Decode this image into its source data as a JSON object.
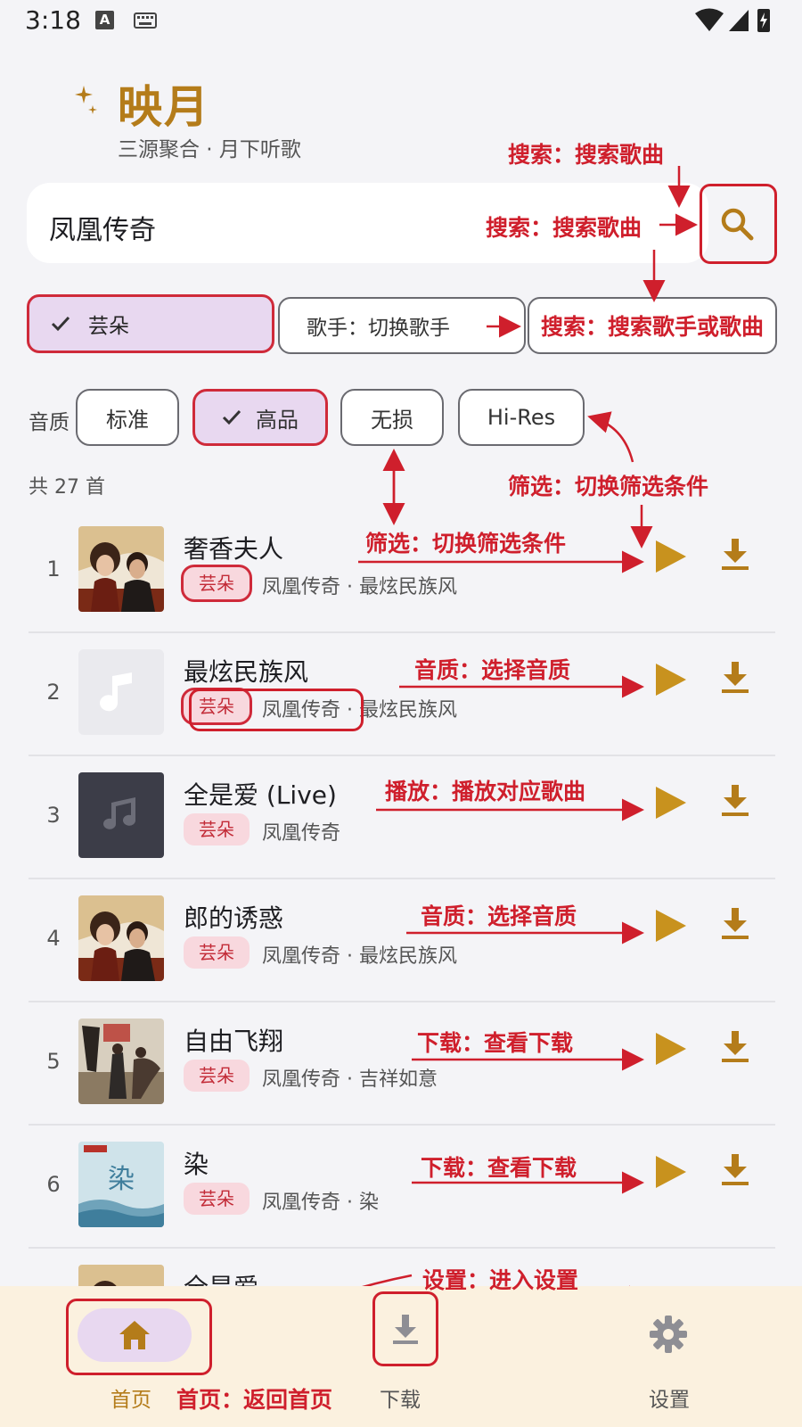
{
  "status": {
    "time": "3:18",
    "a_icon": "A"
  },
  "app": {
    "title": "映月",
    "subtitle": "三源聚合 · 月下听歌"
  },
  "search": {
    "value": "凤凰传奇"
  },
  "sources": [
    {
      "label": "芸朵",
      "active": true
    },
    {
      "label": "歌手：切换歌手",
      "active": false
    },
    {
      "label": "搜索：搜索歌手或歌曲",
      "active": false
    }
  ],
  "quality": {
    "label": "音质",
    "options": [
      {
        "label": "标准",
        "active": false
      },
      {
        "label": "高品",
        "active": true
      },
      {
        "label": "无损",
        "active": false
      },
      {
        "label": "Hi-Res",
        "active": false
      }
    ]
  },
  "list": {
    "count": "共 27 首",
    "songs": [
      {
        "index": "1",
        "title": "奢香夫人",
        "tag": "芸朵",
        "meta": "凤凰传奇 · 最炫民族风",
        "cover": "photo-duo"
      },
      {
        "index": "2",
        "title": "最炫民族风",
        "tag": "芸朵",
        "meta": "凤凰传奇 · 最炫民族风",
        "cover": "placeholder-light"
      },
      {
        "index": "3",
        "title": "全是爱 (Live)",
        "tag": "芸朵",
        "meta": "凤凰传奇",
        "cover": "placeholder-dark"
      },
      {
        "index": "4",
        "title": "郎的诱惑",
        "tag": "芸朵",
        "meta": "凤凰传奇 · 最炫民族风",
        "cover": "photo-duo"
      },
      {
        "index": "5",
        "title": "自由飞翔",
        "tag": "芸朵",
        "meta": "凤凰传奇 · 吉祥如意",
        "cover": "photo-sepia"
      },
      {
        "index": "6",
        "title": "染",
        "tag": "芸朵",
        "meta": "凤凰传奇 · 染",
        "cover": "photo-blue"
      },
      {
        "index": "",
        "title": "全是爱",
        "tag": "",
        "meta": "",
        "cover": "photo-duo"
      }
    ]
  },
  "nav": {
    "home": "首页",
    "downloads": "下载",
    "settings": "设置"
  },
  "annotations": {
    "search_top": "搜索：搜索歌曲",
    "search_mid": "搜索：搜索歌曲",
    "filter_right": "筛选：切换筛选条件",
    "filter_row1": "筛选：切换筛选条件",
    "quality_row2": "音质：选择音质",
    "play_row3": "播放：播放对应歌曲",
    "quality_row4": "音质：选择音质",
    "download_row5": "下载：查看下载",
    "download_row6": "下载：查看下载",
    "settings": "设置：进入设置",
    "home": "首页：返回首页"
  },
  "colors": {
    "accent": "#b47c1a",
    "annotation": "#cf1f2c",
    "chip_active": "#e8d8f0",
    "tag_bg": "#f8d8de"
  }
}
